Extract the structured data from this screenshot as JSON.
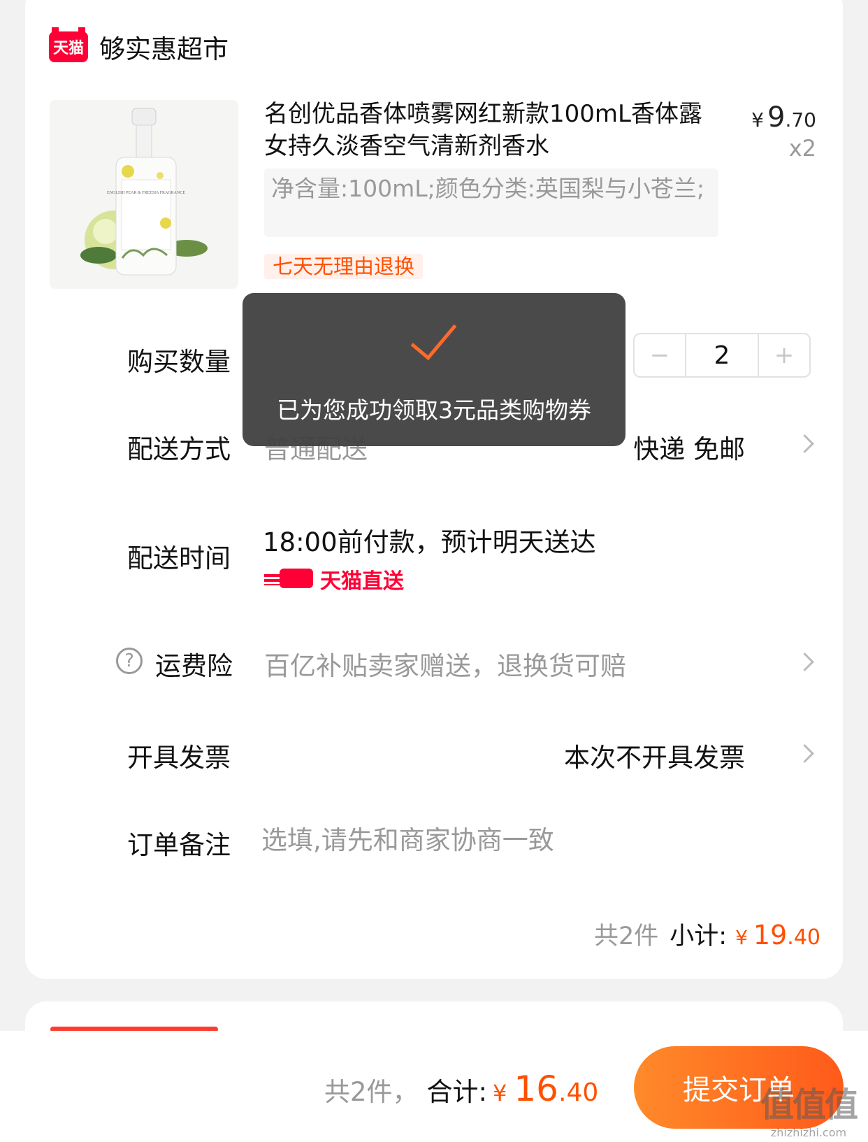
{
  "shop": {
    "logo_text": "天猫",
    "name": "够实惠超市"
  },
  "product": {
    "title": "名创优品香体喷雾网红新款100mL香体露女持久淡香空气清新剂香水",
    "price": {
      "currency": "¥",
      "integer": "9",
      "decimal": ".70"
    },
    "quantity_tag": "x2",
    "sku": "净含量:100mL;颜色分类:英国梨与小苍兰;",
    "badge": "七天无理由退换",
    "package_text": "ENGLISH PEAR & FREESIA FRAGRANCE"
  },
  "quantity": {
    "label": "购买数量",
    "minus": "−",
    "value": "2",
    "plus": "+"
  },
  "shipping": {
    "label": "配送方式",
    "value": "普通配送",
    "right": "快递 免邮"
  },
  "delivery_time": {
    "label": "配送时间",
    "text": "18:00前付款，预计明天送达",
    "badge": "天猫直送"
  },
  "insurance": {
    "label": "运费险",
    "help_icon": "?",
    "value": "百亿补贴卖家赠送，退换货可赔"
  },
  "invoice": {
    "label": "开具发票",
    "value": "本次不开具发票"
  },
  "note": {
    "label": "订单备注",
    "placeholder": "选填,请先和商家协商一致"
  },
  "subtotal": {
    "count": "共2件",
    "label": "小计:",
    "currency": "¥",
    "integer": "19",
    "decimal": ".40"
  },
  "toast": {
    "message": "已为您成功领取3元品类购物券"
  },
  "footer": {
    "count": "共2件，",
    "label": "合计:",
    "currency": "¥",
    "integer": "16",
    "decimal": ".40",
    "submit": "提交订单"
  },
  "watermark": {
    "text": "值值值",
    "url": "zhizhizhi.com"
  },
  "colors": {
    "accent": "#ff5000",
    "tmall_red": "#ff0036",
    "submit_start": "#ff8a2a",
    "submit_end": "#ff5a1a"
  }
}
